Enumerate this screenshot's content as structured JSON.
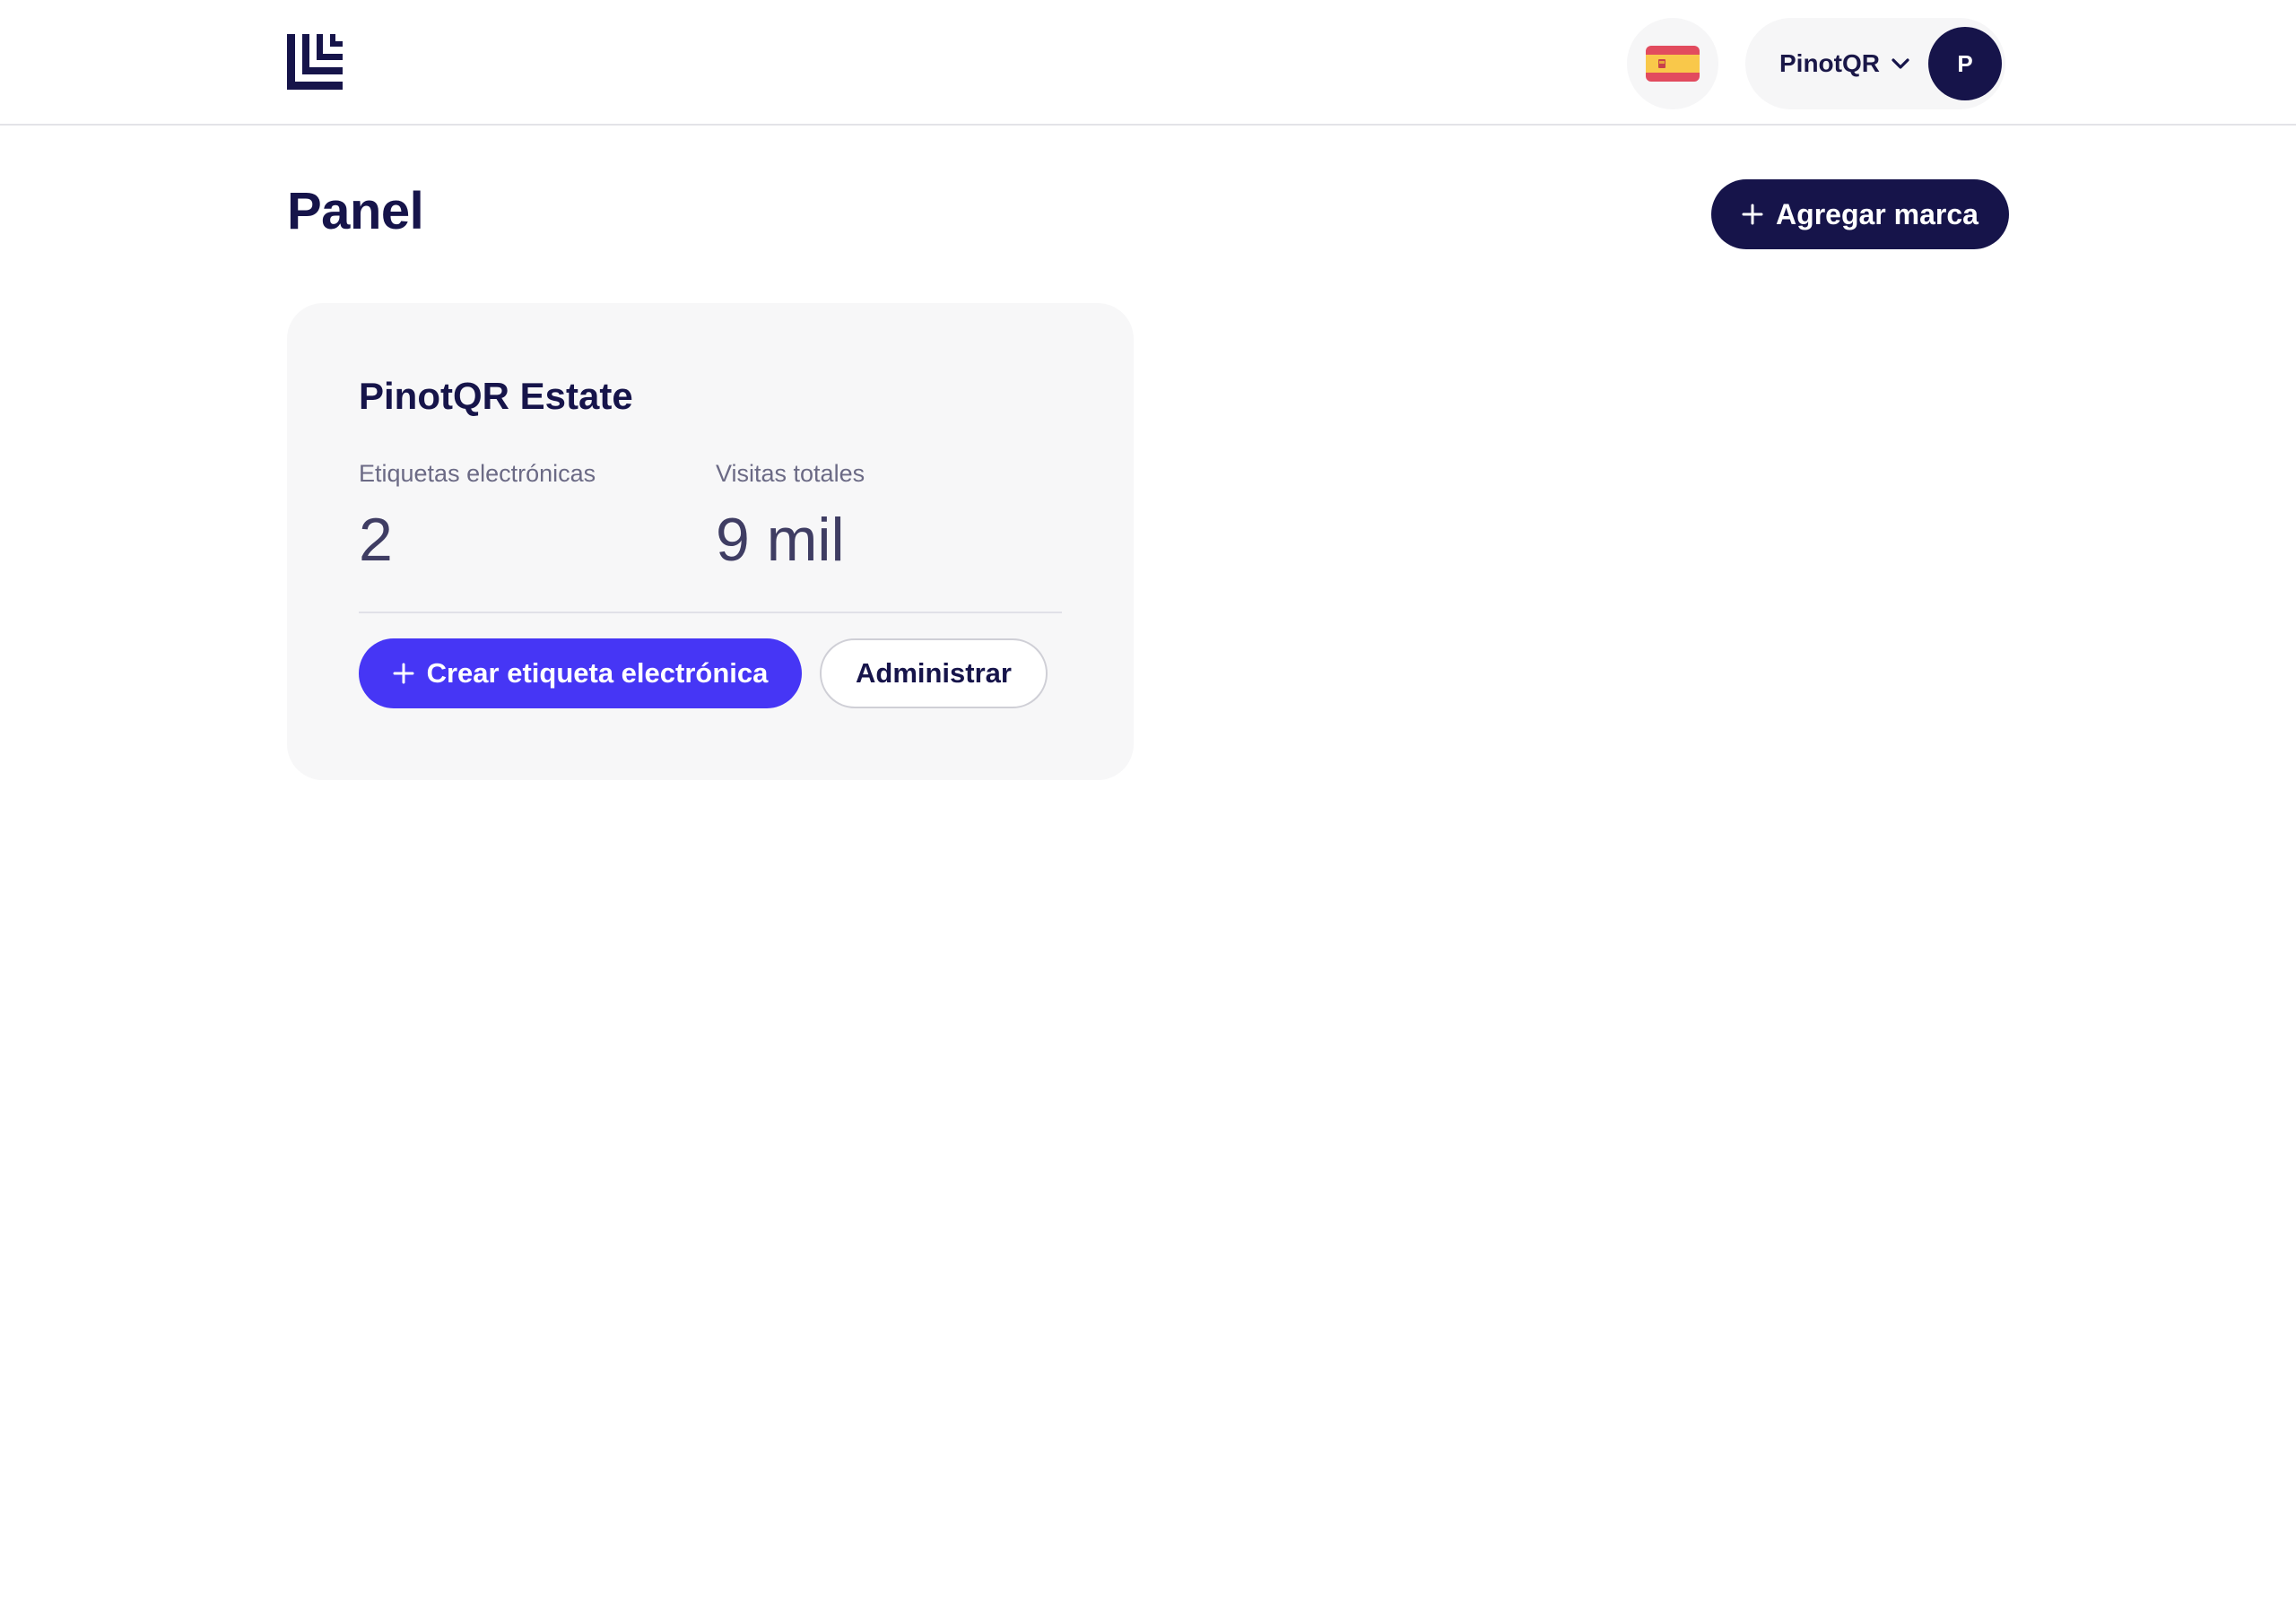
{
  "header": {
    "language": {
      "current": "Español",
      "flag_icon": "spain-flag-icon",
      "flag_colors": {
        "red": "#e24b5e",
        "yellow": "#f9c84a"
      }
    },
    "account": {
      "name": "PinotQR",
      "avatar_initial": "P",
      "dropdown_icon": "chevron-down-icon"
    },
    "logo_icon": "pinotqr-logo-icon"
  },
  "page": {
    "title": "Panel",
    "add_brand_label": "Agregar marca"
  },
  "brand_card": {
    "name": "PinotQR Estate",
    "stats": [
      {
        "label": "Etiquetas electrónicas",
        "value": "2"
      },
      {
        "label": "Visitas totales",
        "value": "9 mil"
      }
    ],
    "create_label_button": "Crear etiqueta electrónica",
    "manage_button": "Administrar"
  },
  "colors": {
    "brand_navy": "#16144a",
    "accent_purple": "#4636f5",
    "card_background": "#f7f7f8",
    "divider": "#e1e1e8"
  }
}
